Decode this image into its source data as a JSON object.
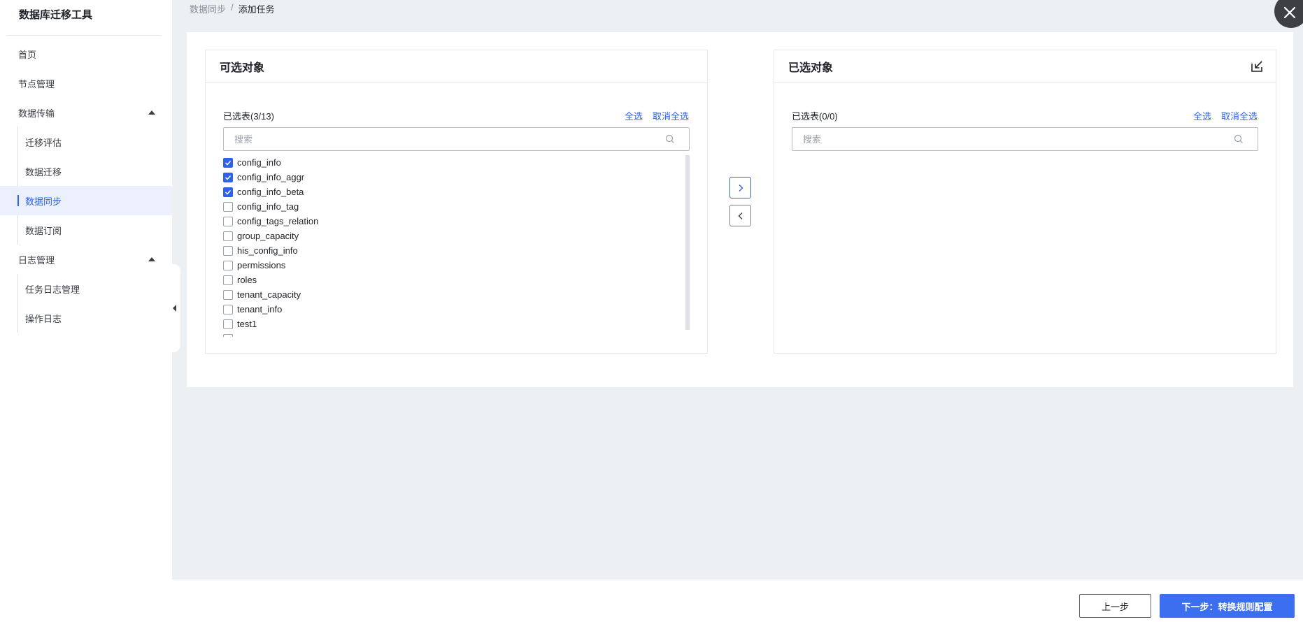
{
  "app": {
    "title": "数据库迁移工具"
  },
  "sidebar": {
    "items": [
      {
        "label": "首页"
      },
      {
        "label": "节点管理"
      },
      {
        "label": "数据传输"
      },
      {
        "label": "迁移评估"
      },
      {
        "label": "数据迁移"
      },
      {
        "label": "数据同步"
      },
      {
        "label": "数据订阅"
      },
      {
        "label": "日志管理"
      },
      {
        "label": "任务日志管理"
      },
      {
        "label": "操作日志"
      }
    ],
    "active": "数据同步"
  },
  "breadcrumb": {
    "parent": "数据同步",
    "separator": "/",
    "current": "添加任务"
  },
  "left_panel": {
    "title": "可选对象",
    "count_label": "已选表(3/13)",
    "select_all": "全选",
    "deselect_all": "取消全选",
    "search_placeholder": "搜索",
    "items": [
      {
        "label": "config_info",
        "checked": true
      },
      {
        "label": "config_info_aggr",
        "checked": true
      },
      {
        "label": "config_info_beta",
        "checked": true
      },
      {
        "label": "config_info_tag",
        "checked": false
      },
      {
        "label": "config_tags_relation",
        "checked": false
      },
      {
        "label": "group_capacity",
        "checked": false
      },
      {
        "label": "his_config_info",
        "checked": false
      },
      {
        "label": "permissions",
        "checked": false
      },
      {
        "label": "roles",
        "checked": false
      },
      {
        "label": "tenant_capacity",
        "checked": false
      },
      {
        "label": "tenant_info",
        "checked": false
      },
      {
        "label": "test1",
        "checked": false
      },
      {
        "label": "users",
        "checked": false
      }
    ]
  },
  "right_panel": {
    "title": "已选对象",
    "count_label": "已选表(0/0)",
    "select_all": "全选",
    "deselect_all": "取消全选",
    "search_placeholder": "搜索"
  },
  "footer": {
    "prev_label": "上一步",
    "next_label": "下一步：转换规则配置"
  },
  "colors": {
    "accent": "#2d63e8",
    "primary_button": "#3c6ff0",
    "page_bg": "#edf0f3"
  },
  "icons": [
    "close-icon",
    "search-icon",
    "export-icon",
    "chevron-right-icon",
    "chevron-left-icon",
    "caret-up-icon",
    "collapse-icon"
  ]
}
